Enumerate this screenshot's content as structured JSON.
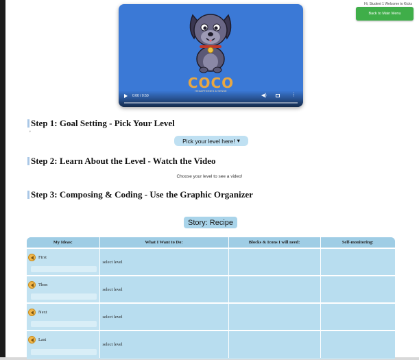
{
  "header": {
    "status_text": "Hi, Student 1 Welcome to Kicks",
    "back_button_label": "Back to Main Menu",
    "back_button_color": "#3fae49"
  },
  "video": {
    "brand_title": "COCO",
    "brand_subtitle": "HEADPHONES & SENSE",
    "time": "0:00 / 0:50",
    "play_icon": "play-icon",
    "volume_icon": "volume-icon",
    "fullscreen_icon": "fullscreen-icon",
    "more_icon": "more-options-icon",
    "progress": 0,
    "background_color": "#3b79d6"
  },
  "steps": [
    {
      "label": "Step 1: Goal Setting - Pick Your Level"
    },
    {
      "label": "Step 2: Learn About the Level - Watch the Video"
    },
    {
      "label": "Step 3: Composing & Coding - Use the Graphic Organizer"
    }
  ],
  "level_picker": {
    "label": "Pick your level here!",
    "chevron": "▾"
  },
  "video_hint": "Choose your level to see a video!",
  "story_label": "Story: Recipe",
  "organizer": {
    "columns": [
      "My Ideas:",
      "What I Want to Do:",
      "Blocks & Icons I will need:",
      "Self-monitoring:"
    ],
    "rows": [
      {
        "idea": "First",
        "action": "select level"
      },
      {
        "idea": "Then",
        "action": "select level"
      },
      {
        "idea": "Next",
        "action": "select level"
      },
      {
        "idea": "Last",
        "action": "select level"
      }
    ],
    "speaker_icon": "speaker-icon",
    "header_color": "#9fcde5",
    "cell_color": "#b8ddef"
  }
}
